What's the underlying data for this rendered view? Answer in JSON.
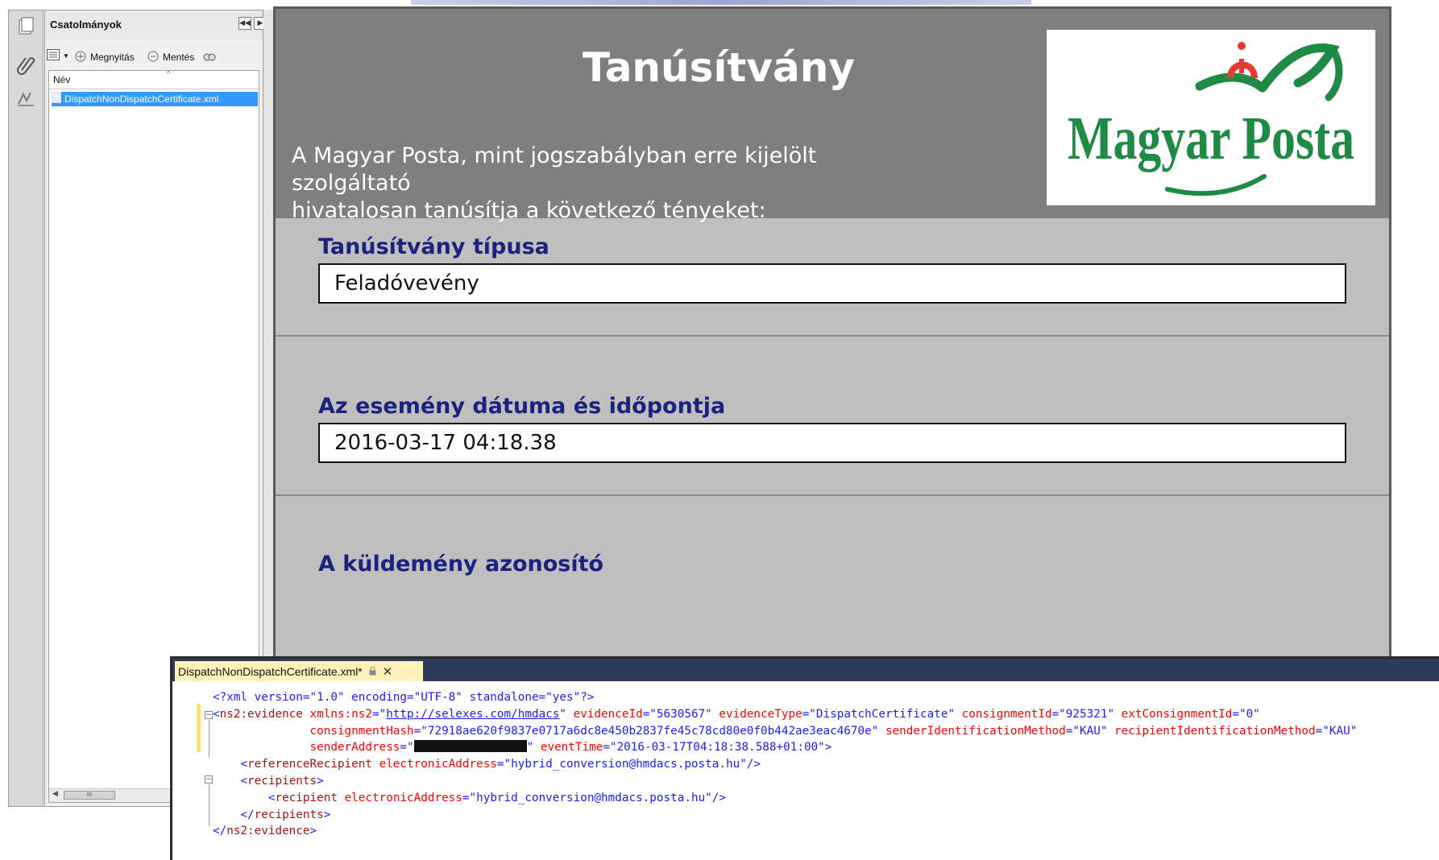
{
  "acrobat": {
    "attachments_title": "Csatolmányok",
    "toolbar": {
      "open_label": "Megnyitás",
      "save_label": "Mentés"
    },
    "column_name": "Név",
    "file_name": "DispatchNonDispatchCertificate.xml",
    "scrollbar_grip": "III"
  },
  "document": {
    "title": "Tanúsítvány",
    "intro_line1": "A Magyar Posta, mint jogszabályban erre kijelölt szolgáltató",
    "intro_line2": "hivatalosan tanúsítja a következő tényeket:",
    "logo_text": "Magyar Posta",
    "sections": [
      {
        "label": "Tanúsítvány típusa",
        "value": "Feladóvevény"
      },
      {
        "label": "Az esemény dátuma és időpontja",
        "value": "2016-03-17 04:18.38"
      },
      {
        "label": "A küldemény azonosító"
      }
    ]
  },
  "xml_editor": {
    "tab_title": "DispatchNonDispatchCertificate.xml*",
    "lines": {
      "pi": "<?xml version=\"1.0\" encoding=\"UTF-8\" standalone=\"yes\"?>",
      "ns_uri": "http://selexes.com/hmdacs",
      "evidence_id": "5630567",
      "evidence_type": "DispatchCertificate",
      "consignment_id": "925321",
      "ext_consignment_id": "0",
      "consignment_hash": "72918ae620f9837e0717a6dc8e450b2837fe45c78cd80e0f0b442ae3eac4670e",
      "sender_method": "KAU",
      "recipient_method": "KAU",
      "event_time": "2016-03-17T04:18:38.588+01:00",
      "ref_recipient_address": "hybrid_conversion@hmdacs.posta.hu",
      "recipient_address": "hybrid_conversion@hmdacs.posta.hu"
    }
  },
  "colors": {
    "doc_header_bg": "#7f7f7f",
    "doc_body_bg": "#bfbfbf",
    "section_label": "#1a237e",
    "selection": "#3399ff",
    "tab_active": "#fff1b8",
    "logo_green": "#1f8a44",
    "logo_red": "#e03c31"
  }
}
